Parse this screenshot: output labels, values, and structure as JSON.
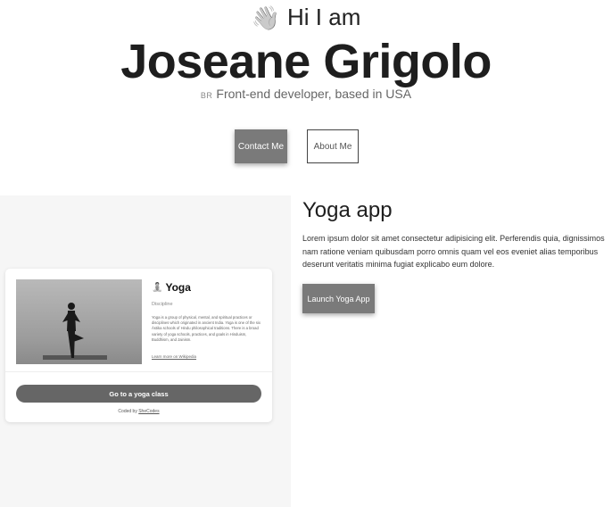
{
  "hero": {
    "greeting": "Hi I am",
    "name": "Joseane Grigolo",
    "flag_code": "BR",
    "tagline": "Front-end developer, based in USA",
    "contact_label": "Contact Me",
    "about_label": "About Me"
  },
  "project": {
    "title": "Yoga app",
    "description": "Lorem ipsum dolor sit amet consectetur adipisicing elit. Perferendis quia, dignissimos nam ratione veniam quibusdam porro omnis quam vel eos eveniet alias temporibus deserunt veritatis minima fugiat explicabo eum dolore.",
    "launch_label": "Launch Yoga App",
    "preview": {
      "title": "Yoga",
      "subtitle": "Discipline",
      "text": "Yoga is a group of physical, mental, and spiritual practices or disciplines which originated in ancient India. Yoga is one of the six Āstika schools of Hindu philosophical traditions. There is a broad variety of yoga schools, practices, and goals in Hinduism, Buddhism, and Jainism.",
      "link_label": "Learn more on Wikipedia",
      "button_label": "Go to a yoga class",
      "credit_prefix": "Coded by",
      "credit_name": "SheCodes"
    }
  },
  "icons": {
    "greeting": "waving-hand-icon",
    "yoga": "lotus-position-icon"
  },
  "colors": {
    "button_bg": "#7a7a7a",
    "preview_bg": "#f6f6f6"
  }
}
